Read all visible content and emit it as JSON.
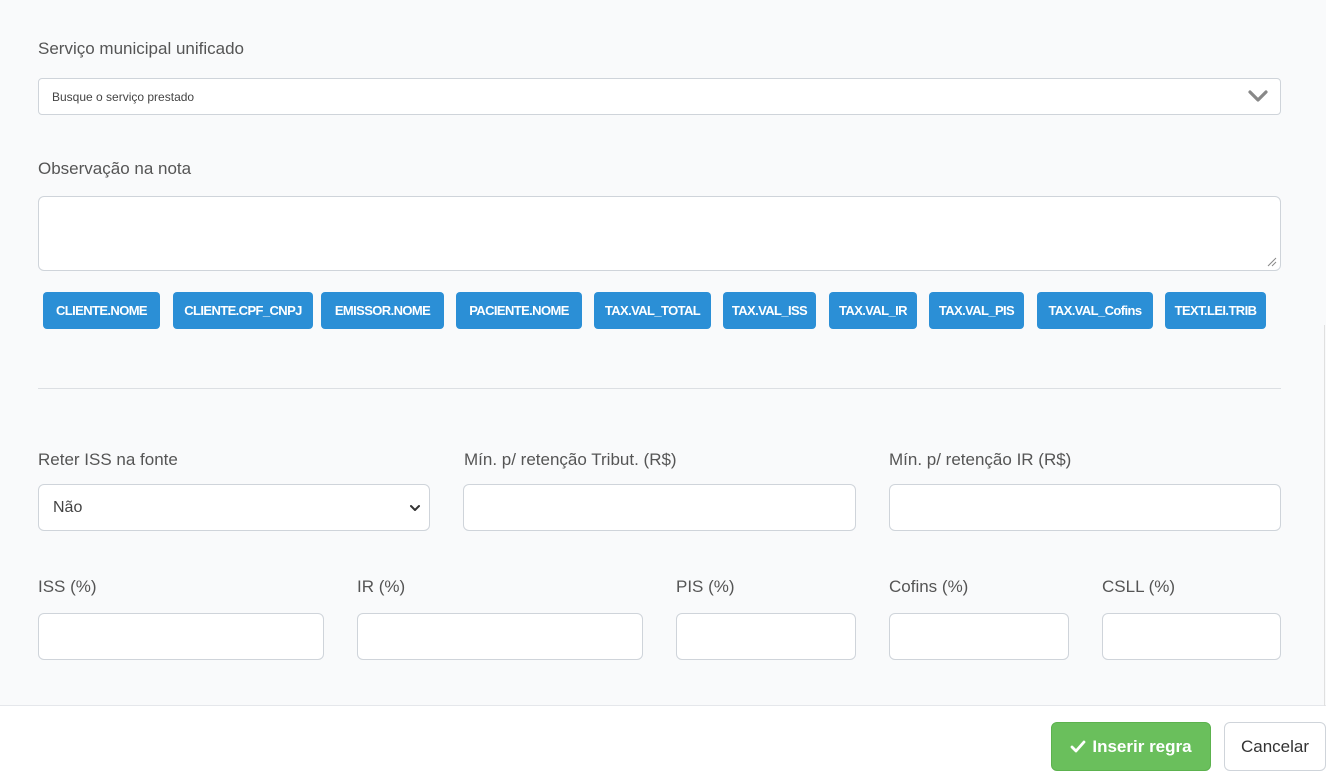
{
  "servico": {
    "label": "Serviço municipal unificado",
    "placeholder": "Busque o serviço prestado"
  },
  "observacao": {
    "label": "Observação na nota",
    "value": ""
  },
  "tags": [
    "CLIENTE.NOME",
    "CLIENTE.CPF_CNPJ",
    "EMISSOR.NOME",
    "PACIENTE.NOME",
    "TAX.VAL_TOTAL",
    "TAX.VAL_ISS",
    "TAX.VAL_IR",
    "TAX.VAL_PIS",
    "TAX.VAL_Cofins",
    "TEXT.LEI.TRIB"
  ],
  "reter_iss": {
    "label": "Reter ISS na fonte",
    "value": "Não"
  },
  "min_tributos": {
    "label": "Mín. p/ retenção Tribut. (R$)",
    "value": ""
  },
  "min_ir": {
    "label": "Mín. p/ retenção IR (R$)",
    "value": ""
  },
  "aliquotas": {
    "iss": {
      "label": "ISS (%)",
      "value": ""
    },
    "ir": {
      "label": "IR (%)",
      "value": ""
    },
    "pis": {
      "label": "PIS (%)",
      "value": ""
    },
    "cofins": {
      "label": "Cofins (%)",
      "value": ""
    },
    "csll": {
      "label": "CSLL (%)",
      "value": ""
    }
  },
  "footer": {
    "insert_label": "Inserir regra",
    "cancel_label": "Cancelar"
  },
  "colors": {
    "tag_bg": "#2b8fd6",
    "insert_bg": "#6abf5c"
  },
  "icons": {
    "select_chevron": "chevron-down-icon",
    "insert_check": "check-icon"
  }
}
